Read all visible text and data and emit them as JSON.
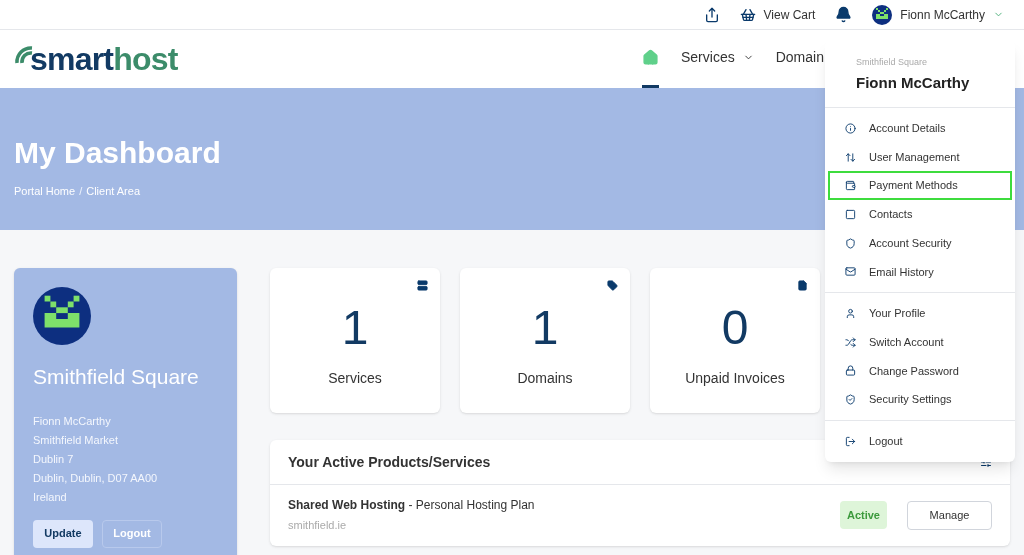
{
  "top_bar": {
    "cart": "View Cart",
    "user": "Fionn McCarthy"
  },
  "logo": {
    "part_1": "smart",
    "part_2": "host"
  },
  "nav": [
    {
      "kind": "home",
      "selected": true
    },
    {
      "kind": "menu",
      "label": "Services",
      "selected": false
    },
    {
      "kind": "link",
      "label": "Domain",
      "selected": false
    }
  ],
  "hero": {
    "title": "My Dashboard",
    "breadcrumb": [
      "Portal Home",
      "Client Area"
    ],
    "separator": "/"
  },
  "profile": {
    "name": "Smithfield Square",
    "address": [
      "Fionn McCarthy",
      "Smithfield Market",
      "Dublin 7",
      "Dublin, Dublin, D07 AA00",
      "Ireland"
    ],
    "buttons": [
      "Update",
      "Logout"
    ]
  },
  "stats": [
    {
      "value": "1",
      "label": "Services"
    },
    {
      "value": "1",
      "label": "Domains"
    },
    {
      "value": "0",
      "label": "Unpaid Invoices"
    }
  ],
  "products": {
    "title": "Your Active Products/Services",
    "rows": [
      {
        "product": "**Shared Web Hosting** - Personal Hosting Plan",
        "domain": "smithfield.ie",
        "status": "Active",
        "action": "Manage"
      }
    ]
  },
  "user_menu": {
    "company": "Smithfield Square",
    "name": "Fionn McCarthy",
    "groups": [
      [
        {
          "label": "Account Details",
          "highlighted": false
        },
        {
          "label": "User Management",
          "highlighted": false
        },
        {
          "label": "Payment Methods",
          "highlighted": true
        },
        {
          "label": "Contacts",
          "highlighted": false
        },
        {
          "label": "Account Security",
          "highlighted": false
        },
        {
          "label": "Email History",
          "highlighted": false
        }
      ],
      [
        {
          "label": "Your Profile",
          "highlighted": false
        },
        {
          "label": "Switch Account",
          "highlighted": false
        },
        {
          "label": "Change Password",
          "highlighted": false
        },
        {
          "label": "Security Settings",
          "highlighted": false
        }
      ],
      [
        {
          "label": "Logout",
          "highlighted": false
        }
      ]
    ]
  }
}
